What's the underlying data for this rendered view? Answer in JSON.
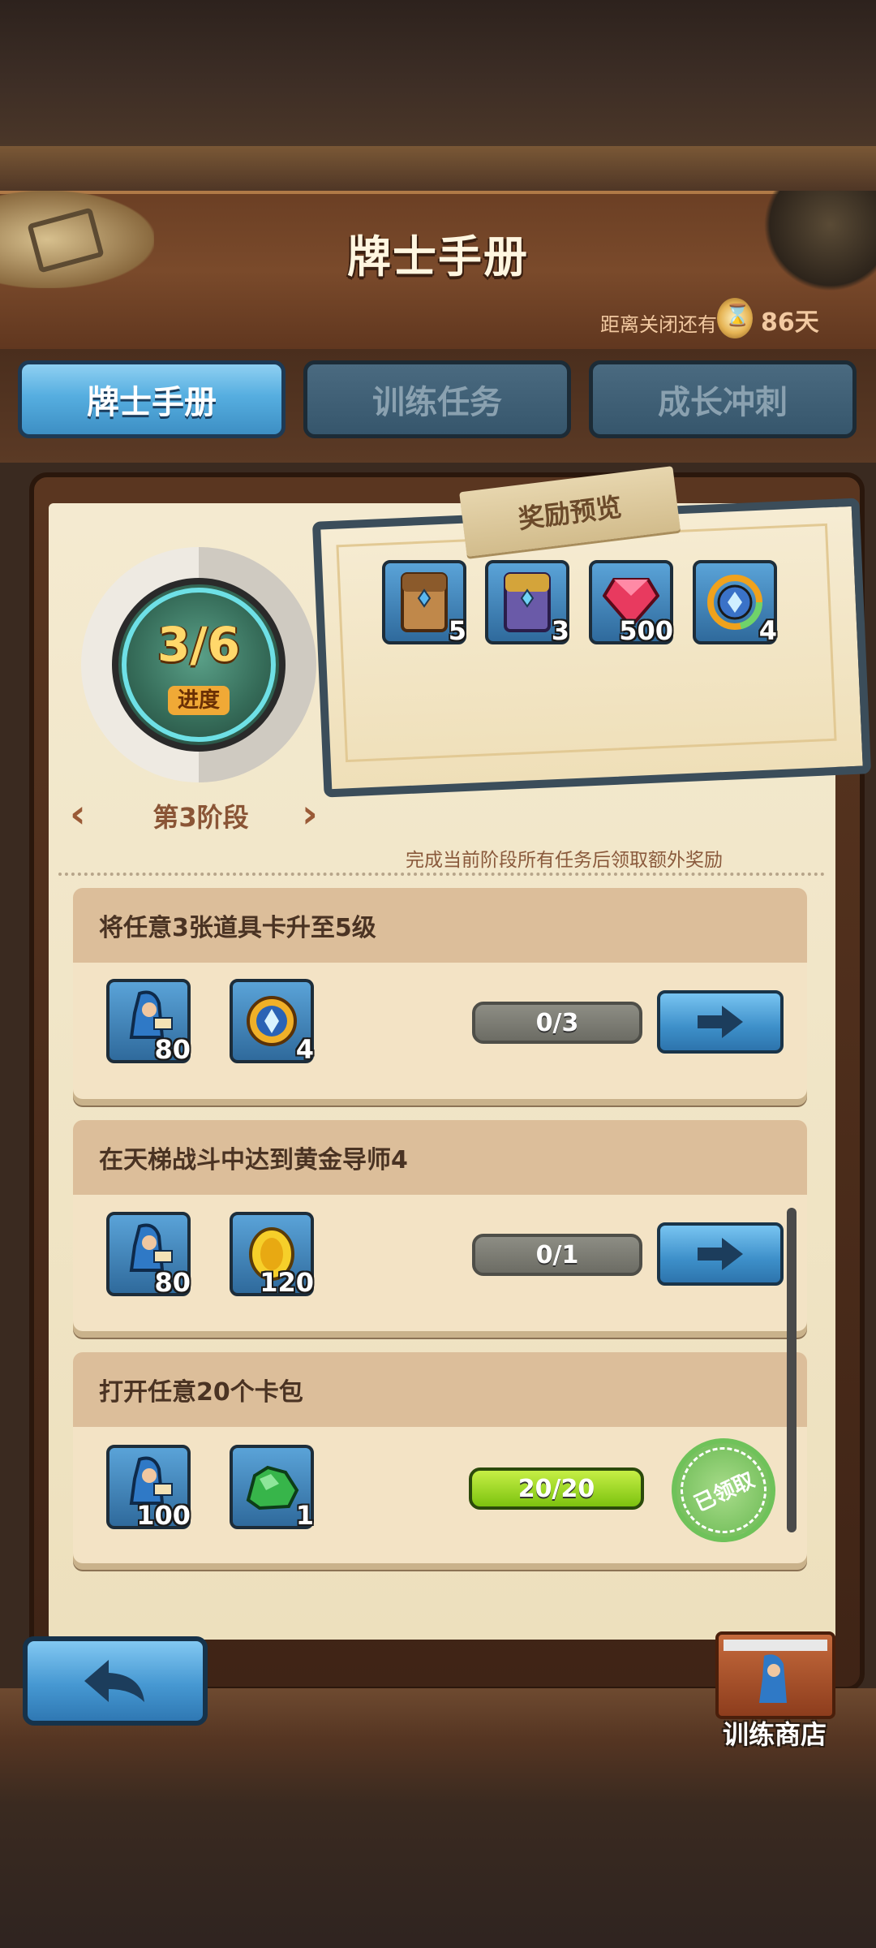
{
  "header": {
    "title": "牌士手册",
    "countdown_label": "距离关闭还有",
    "countdown_days": "86天"
  },
  "tabs": [
    {
      "label": "牌士手册",
      "active": true
    },
    {
      "label": "训练任务",
      "active": false
    },
    {
      "label": "成长冲刺",
      "active": false
    }
  ],
  "stage": {
    "progress_text": "3/6",
    "progress_fraction": 0.5,
    "progress_label": "进度",
    "name": "第3阶段"
  },
  "reward_preview": {
    "title": "奖励预览",
    "items": [
      {
        "icon": "brown-card-pack-icon",
        "count": "5"
      },
      {
        "icon": "purple-card-pack-icon",
        "count": "3"
      },
      {
        "icon": "red-gem-icon",
        "count": "500"
      },
      {
        "icon": "rainbow-orb-icon",
        "count": "4"
      }
    ],
    "note": "完成当前阶段所有任务后领取额外奖励"
  },
  "quests": [
    {
      "title": "将任意3张道具卡升至5级",
      "rewards": [
        {
          "icon": "trainer-xp-icon",
          "count": "80"
        },
        {
          "icon": "gold-crystal-coin-icon",
          "count": "4"
        }
      ],
      "progress": "0/3",
      "status": "go"
    },
    {
      "title": "在天梯战斗中达到黄金导师4",
      "rewards": [
        {
          "icon": "trainer-xp-icon",
          "count": "80"
        },
        {
          "icon": "gold-coin-icon",
          "count": "120"
        }
      ],
      "progress": "0/1",
      "status": "go"
    },
    {
      "title": "打开任意20个卡包",
      "rewards": [
        {
          "icon": "trainer-xp-icon",
          "count": "100"
        },
        {
          "icon": "green-gem-icon",
          "count": "1"
        }
      ],
      "progress": "20/20",
      "status": "claimed",
      "claimed_label": "已领取"
    }
  ],
  "footer": {
    "shop_label": "训练商店"
  }
}
